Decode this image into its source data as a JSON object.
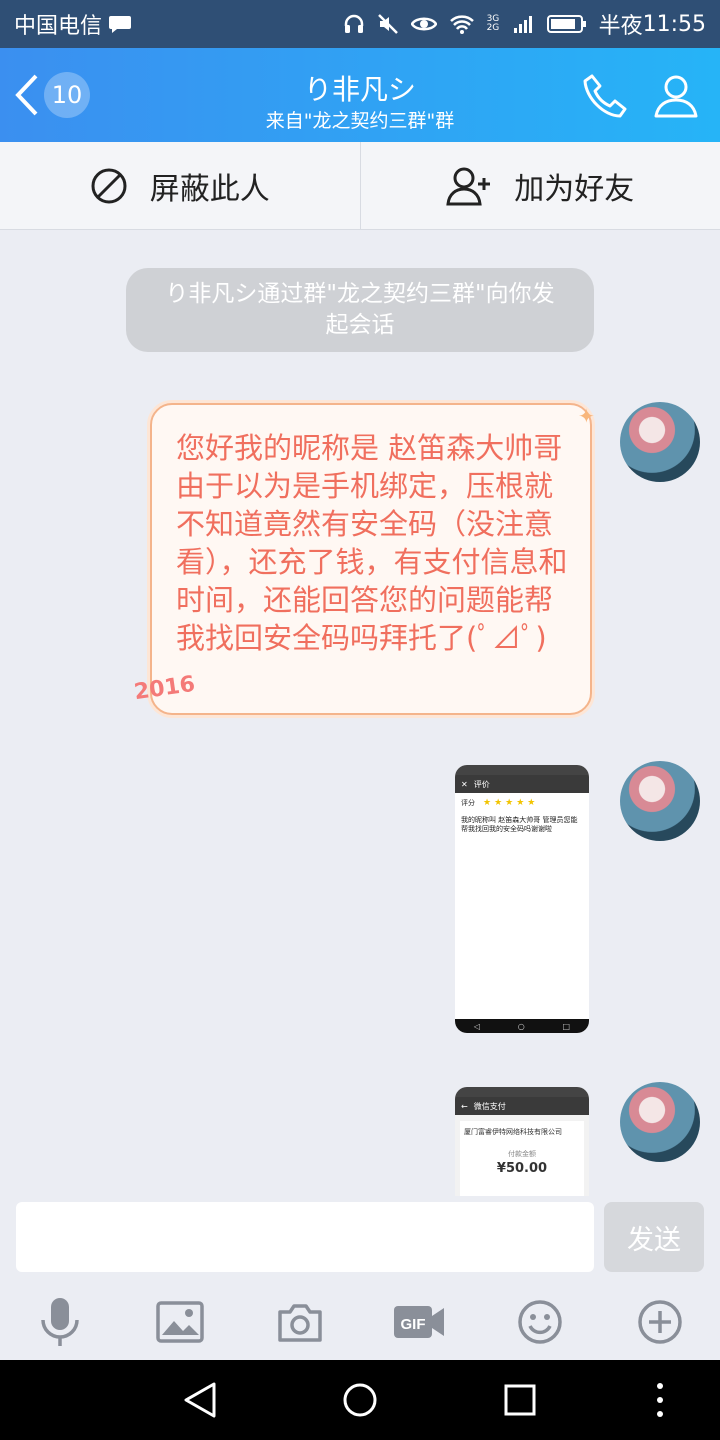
{
  "status": {
    "carrier": "中国电信",
    "network": "3G 2G",
    "time_prefix": "半夜",
    "time": "11:55"
  },
  "header": {
    "back_count": "10",
    "title": "り非凡シ",
    "subtitle": "来自\"龙之契约三群\"群"
  },
  "actions": {
    "block": "屏蔽此人",
    "add_friend": "加为好友"
  },
  "system_message": "り非凡シ通过群\"龙之契约三群\"向你发起会话",
  "messages": {
    "text": "您好我的昵称是  赵笛森大帅哥 由于以为是手机绑定，压根就不知道竟然有安全码（没注意看），还充了钱，有支付信息和时间，还能回答您的问题能帮我找回安全码吗拜托了(ﾟ⊿ﾟ)",
    "bubble_deco": "2016",
    "shot1": {
      "title": "评价",
      "rating_label": "评分",
      "stars": "★★★★★",
      "comment": "我的昵称叫 赵笛森大帅哥 管理员您能帮我找回我的安全码吗谢谢啦"
    },
    "shot2": {
      "title": "微信支付",
      "merchant": "厦门富睿伊特网络科技有限公司",
      "amount_label": "付款金额",
      "amount": "¥50.00"
    }
  },
  "input": {
    "placeholder": "",
    "send": "发送"
  },
  "toolbar": [
    "mic-icon",
    "image-icon",
    "camera-icon",
    "gif-icon",
    "emoji-icon",
    "plus-icon"
  ],
  "colors": {
    "header_start": "#3b8ff0",
    "header_end": "#26b4f7",
    "bubble_text": "#f06f5e",
    "bubble_border": "#f4b48b"
  }
}
